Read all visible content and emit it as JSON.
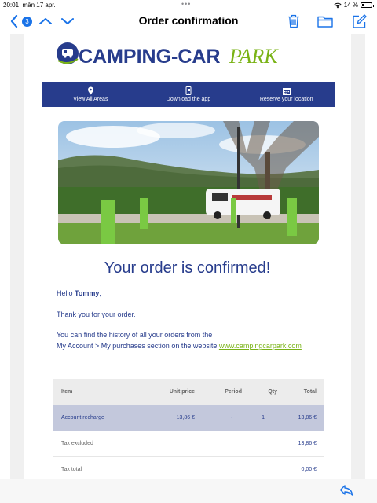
{
  "status": {
    "time": "20:01",
    "date": "mån 17 apr.",
    "battery_percent": "14 %",
    "battery_level": 0.14,
    "dots": "•••"
  },
  "nav": {
    "unread_count": "3",
    "title": "Order confirmation",
    "icons": [
      "back-chevron-icon",
      "chevron-up-icon",
      "chevron-down-icon",
      "trash-icon",
      "folder-icon",
      "compose-icon"
    ]
  },
  "logo": {
    "brand_main": "CAMPING-CAR",
    "brand_accent": "PARK",
    "colors": {
      "main": "#273c8c",
      "accent": "#7ab317"
    }
  },
  "banner": {
    "items": [
      {
        "label": "View All Areas",
        "icon": "location-pin-icon"
      },
      {
        "label": "Download the app",
        "icon": "phone-icon"
      },
      {
        "label": "Reserve your location",
        "icon": "calendar-icon"
      }
    ],
    "color": "#273c8c"
  },
  "content": {
    "headline": "Your order is confirmed!",
    "greeting_prefix": "Hello ",
    "name": "Tommy",
    "greeting_suffix": ",",
    "thanks": "Thank you for your order.",
    "history_line1": "You can find the history of all your orders from the",
    "history_line2": "My Account > My purchases section on the website ",
    "website": "www.campingcarpark.com"
  },
  "table": {
    "headers": {
      "item": "Item",
      "unit_price": "Unit price",
      "period": "Period",
      "qty": "Qty",
      "total": "Total"
    },
    "row": {
      "item": "Account recharge",
      "unit_price": "13,86 €",
      "period": "-",
      "qty": "1",
      "total": "13,86 €"
    },
    "tax_excluded": {
      "label": "Tax excluded",
      "value": "13,86 €"
    },
    "tax_total": {
      "label": "Tax total",
      "value": "0,00 €"
    }
  },
  "bottom": {
    "icon": "reply-icon"
  }
}
